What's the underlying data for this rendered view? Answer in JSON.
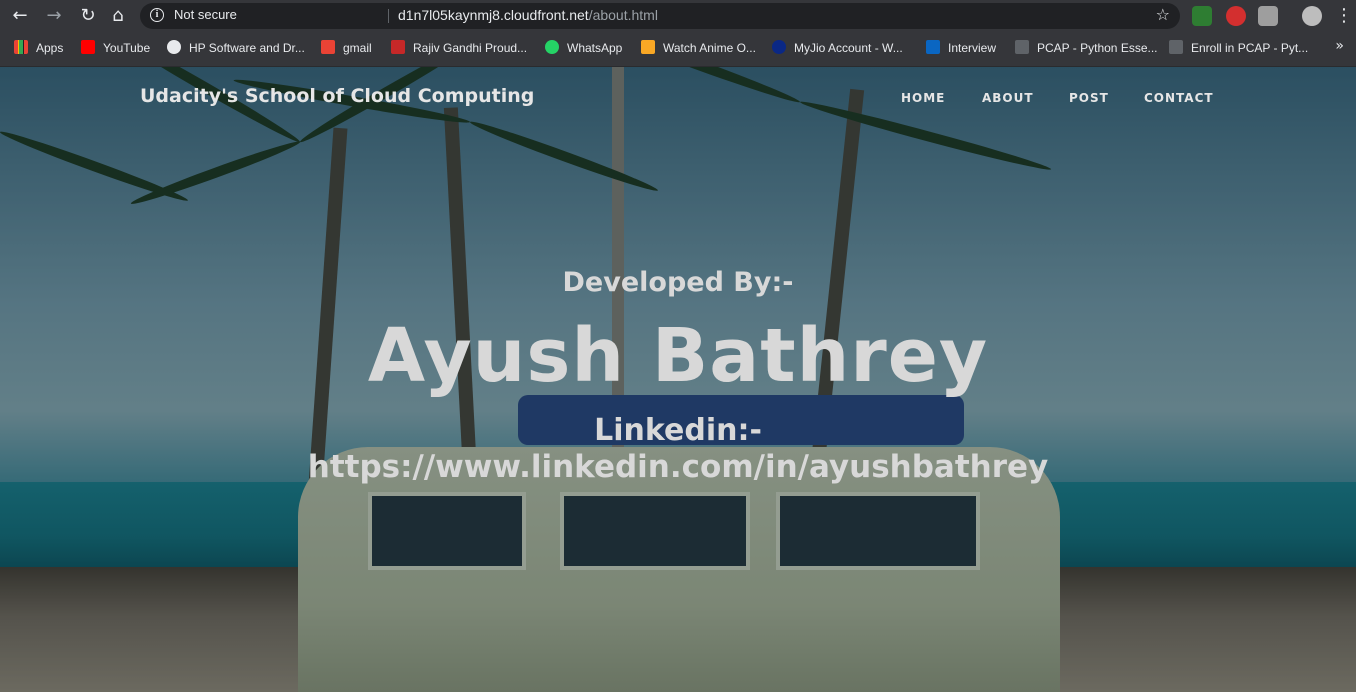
{
  "browser": {
    "security_label": "Not secure",
    "url_host": "d1n7l05kaynmj8.cloudfront.net",
    "url_path": "/about.html"
  },
  "bookmarks": [
    {
      "label": "Apps",
      "icon": "apps-grid-icon",
      "color": "#f4b400"
    },
    {
      "label": "YouTube",
      "icon": "youtube-icon",
      "color": "#ff0000"
    },
    {
      "label": "HP Software and Dr...",
      "icon": "globe-icon",
      "color": "#e8eaed"
    },
    {
      "label": "gmail",
      "icon": "gmail-icon",
      "color": "#ea4335"
    },
    {
      "label": "Rajiv Gandhi Proud...",
      "icon": "university-icon",
      "color": "#c62828"
    },
    {
      "label": "WhatsApp",
      "icon": "whatsapp-icon",
      "color": "#25d366"
    },
    {
      "label": "Watch Anime O...",
      "icon": "crown-icon",
      "color": "#f9a825"
    },
    {
      "label": "MyJio Account - W...",
      "icon": "jio-icon",
      "color": "#0a2885"
    },
    {
      "label": "Interview",
      "icon": "linkedin-icon",
      "color": "#0a66c2"
    },
    {
      "label": "PCAP - Python Esse...",
      "icon": "cisco-icon",
      "color": "#9aa0a6"
    },
    {
      "label": "Enroll in PCAP - Pyt...",
      "icon": "cisco-icon",
      "color": "#9aa0a6"
    }
  ],
  "site": {
    "brand": "Udacity's School of Cloud Computing",
    "nav": [
      "HOME",
      "ABOUT",
      "POST",
      "CONTACT"
    ],
    "developed_by": "Developed By:-",
    "author": "Ayush Bathrey",
    "linkedin_label": "Linkedin:-",
    "linkedin_url": "https://www.linkedin.com/in/ayushbathrey"
  },
  "colors": {
    "browser_chrome": "#35363a",
    "hero_text": "#d8d8d8"
  }
}
